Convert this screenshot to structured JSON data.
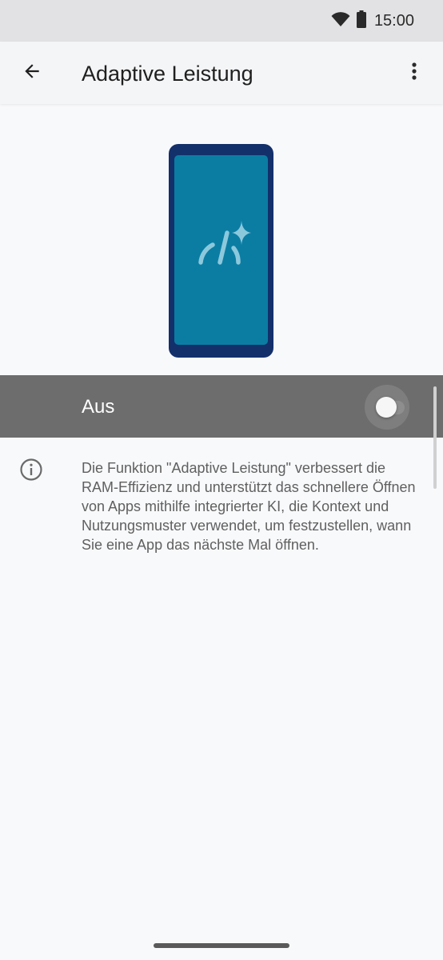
{
  "status_bar": {
    "time": "15:00",
    "icons": [
      "wifi-icon",
      "battery-icon"
    ]
  },
  "app_bar": {
    "title": "Adaptive Leistung",
    "back_icon": "arrow-left-icon",
    "menu_icon": "more-vert-icon"
  },
  "illustration": {
    "icon": "adaptive-performance-gauge-sparkle-icon",
    "colors": {
      "frame": "#13306a",
      "screen": "#0b7da3",
      "glyph": "#8cc8dc"
    }
  },
  "main_toggle": {
    "label": "Aus",
    "state": "off"
  },
  "info": {
    "icon": "info-icon",
    "text": "Die Funktion \"Adaptive Leistung\" verbessert die RAM-Effizienz und unterstützt das schnellere Öffnen von Apps mithilfe integrierter KI, die Kontext und Nutzungsmuster verwendet, um festzustellen, wann Sie eine App das nächste Mal öffnen."
  },
  "colors": {
    "background": "#f8f9fb",
    "status_bar": "#e2e2e4",
    "app_bar": "#f4f5f7",
    "toggle_row": "#6d6d6d"
  }
}
